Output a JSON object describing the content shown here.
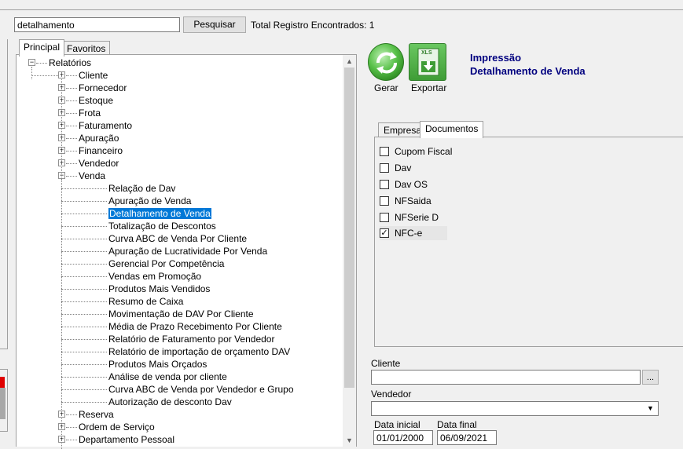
{
  "search": {
    "value": "detalhamento",
    "button_label": "Pesquisar",
    "total_label": "Total Registro Encontrados: 1"
  },
  "left_tabs": [
    {
      "label": "Principal",
      "active": true
    },
    {
      "label": "Favoritos",
      "active": false
    }
  ],
  "tree": {
    "root": "Relatórios",
    "categories_top": [
      {
        "label": "Cliente",
        "expander": "+"
      },
      {
        "label": "Fornecedor",
        "expander": "+"
      },
      {
        "label": "Estoque",
        "expander": "+"
      },
      {
        "label": "Frota",
        "expander": "+"
      },
      {
        "label": "Faturamento",
        "expander": "+"
      },
      {
        "label": "Apuração",
        "expander": "+"
      },
      {
        "label": "Financeiro",
        "expander": "+"
      },
      {
        "label": "Vendedor",
        "expander": "+"
      },
      {
        "label": "Venda",
        "expander": "−"
      }
    ],
    "venda_children": [
      "Relação de Dav",
      "Apuração de Venda",
      "Detalhamento de Venda",
      "Totalização de Descontos",
      "Curva ABC de Venda Por Cliente",
      "Apuração de Lucratividade Por Venda",
      "Gerencial Por Competência",
      "Vendas em Promoção",
      "Produtos Mais Vendidos",
      "Resumo de Caixa",
      "Movimentação de DAV Por Cliente",
      "Média de Prazo Recebimento Por Cliente",
      "Relatório de Faturamento por Vendedor",
      "Relatório de importação de orçamento DAV",
      "Produtos Mais Orçados",
      "Análise de venda por cliente",
      "Curva ABC de Venda por Vendedor e Grupo",
      "Autorização de desconto Dav"
    ],
    "selected": "Detalhamento de Venda",
    "categories_bottom": [
      {
        "label": "Reserva",
        "expander": "+"
      },
      {
        "label": "Ordem de Serviço",
        "expander": "+"
      },
      {
        "label": "Departamento Pessoal",
        "expander": "+"
      }
    ]
  },
  "actions": {
    "gerar_label": "Gerar",
    "exportar_label": "Exportar",
    "exportar_badge": "XLS"
  },
  "report_title": {
    "line1": "Impressão",
    "line2": "Detalhamento de Venda"
  },
  "right_tabs": [
    {
      "label": "Empresa",
      "active": false
    },
    {
      "label": "Documentos",
      "active": true
    }
  ],
  "documents": [
    {
      "label": "Cupom Fiscal",
      "checked": false
    },
    {
      "label": "Dav",
      "checked": false
    },
    {
      "label": "Dav OS",
      "checked": false
    },
    {
      "label": "NFSaida",
      "checked": false
    },
    {
      "label": "NFSerie D",
      "checked": false
    },
    {
      "label": "NFC-e",
      "checked": true
    }
  ],
  "form": {
    "cliente_label": "Cliente",
    "cliente_value": "",
    "cliente_button": "...",
    "vendedor_label": "Vendedor",
    "vendedor_value": "",
    "data_inicial_label": "Data inicial",
    "data_inicial_value": "01/01/2000",
    "data_final_label": "Data final",
    "data_final_value": "06/09/2021"
  },
  "colors": {
    "selection": "#0078d7",
    "title": "#00007f",
    "accent_green": "#57c048"
  }
}
